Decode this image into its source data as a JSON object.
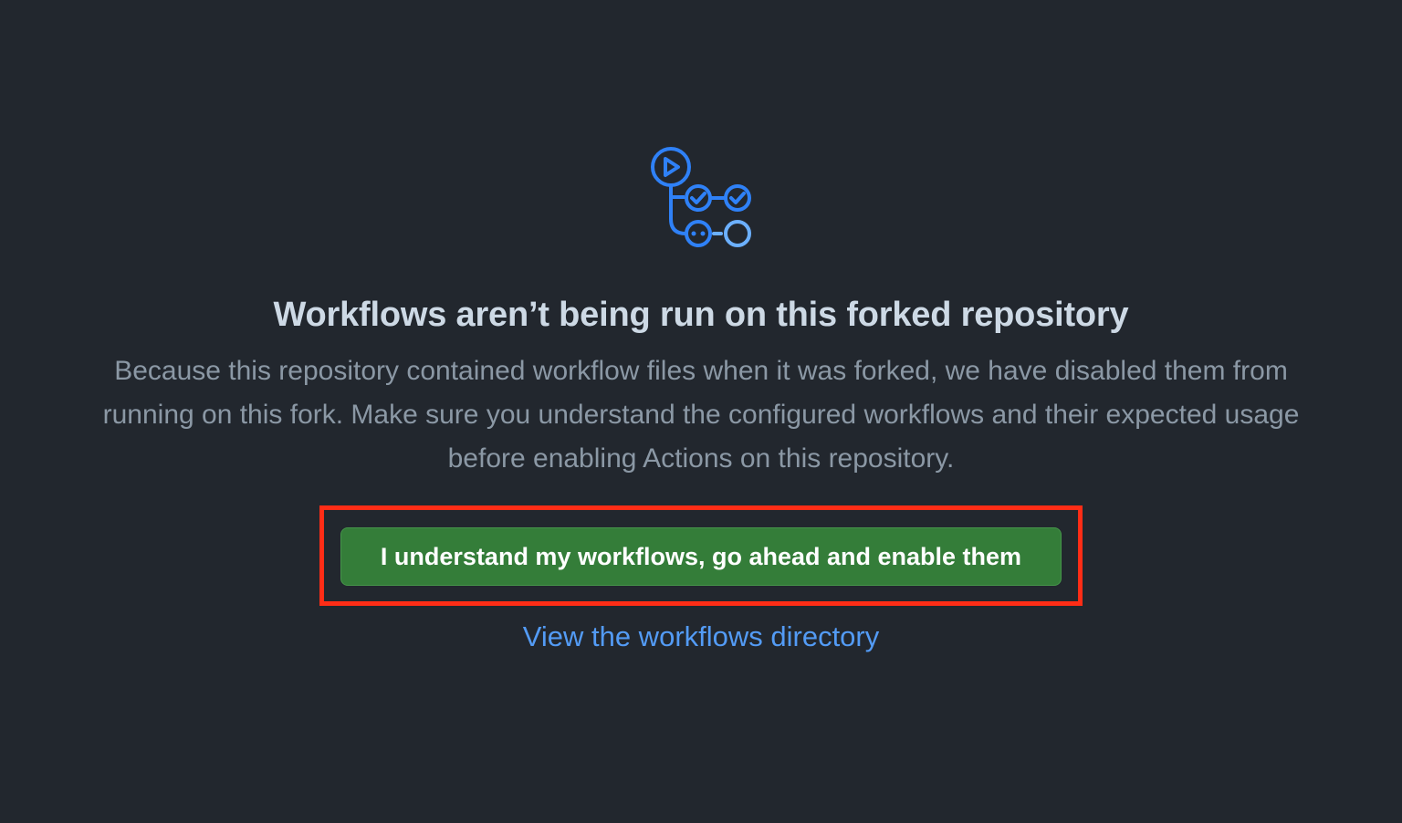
{
  "blankslate": {
    "icon": "workflow-icon",
    "title": "Workflows aren’t being run on this forked repository",
    "description": "Because this repository contained workflow files when it was forked, we have disabled them from running on this fork. Make sure you understand the configured workflows and their expected usage before enabling Actions on this repository.",
    "enable_button_label": "I understand my workflows, go ahead and enable them",
    "workflows_link_label": "View the workflows directory"
  },
  "colors": {
    "background": "#22272e",
    "title": "#cdd9e5",
    "description": "#8b98a5",
    "button_bg": "#347d39",
    "link": "#539bf5",
    "icon_primary": "#2f81f7",
    "icon_secondary": "#6cb0ff",
    "highlight": "#ff2d16"
  }
}
